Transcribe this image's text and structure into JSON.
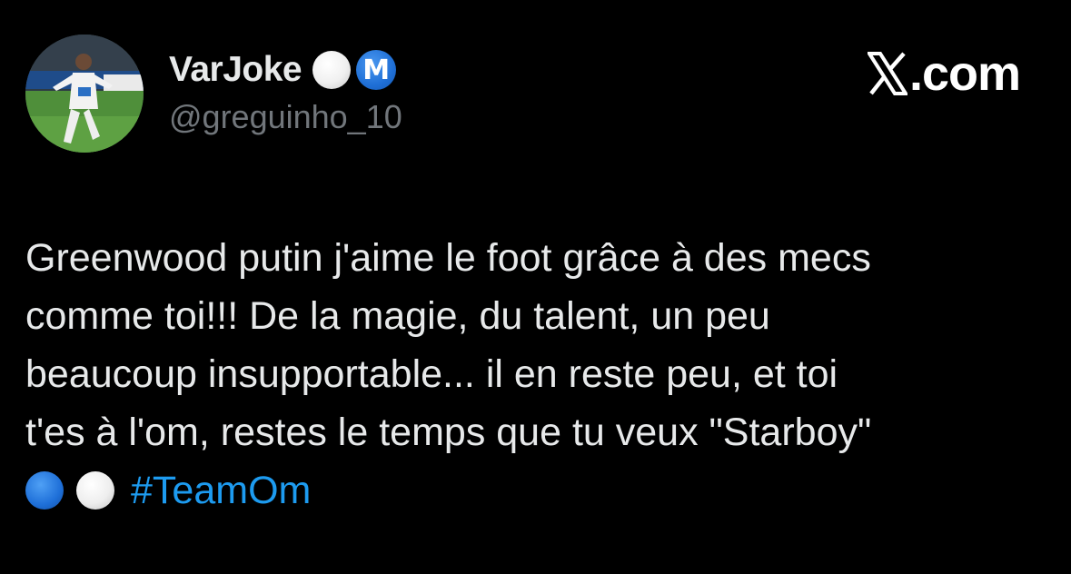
{
  "tweet": {
    "display_name": "VarJoke",
    "handle": "@greguinho_10",
    "badges": [
      "white-circle-emoji",
      "m-badge"
    ],
    "badge_m_letter": "M",
    "brand": ".com",
    "text_lines": [
      "Greenwood putin j'aime le foot grâce à des mecs",
      "comme toi!!! De la magie, du talent, un peu",
      "beaucoup insupportable... il en reste peu, et toi",
      "t'es à l'om, restes le temps que tu veux \"Starboy\""
    ],
    "hashtag": "#TeamOm",
    "trailing_emojis": [
      "blue-circle-emoji",
      "white-circle-emoji"
    ]
  },
  "colors": {
    "background": "#000000",
    "text": "#e7e9ea",
    "muted": "#71767b",
    "link": "#1d9bf0"
  }
}
